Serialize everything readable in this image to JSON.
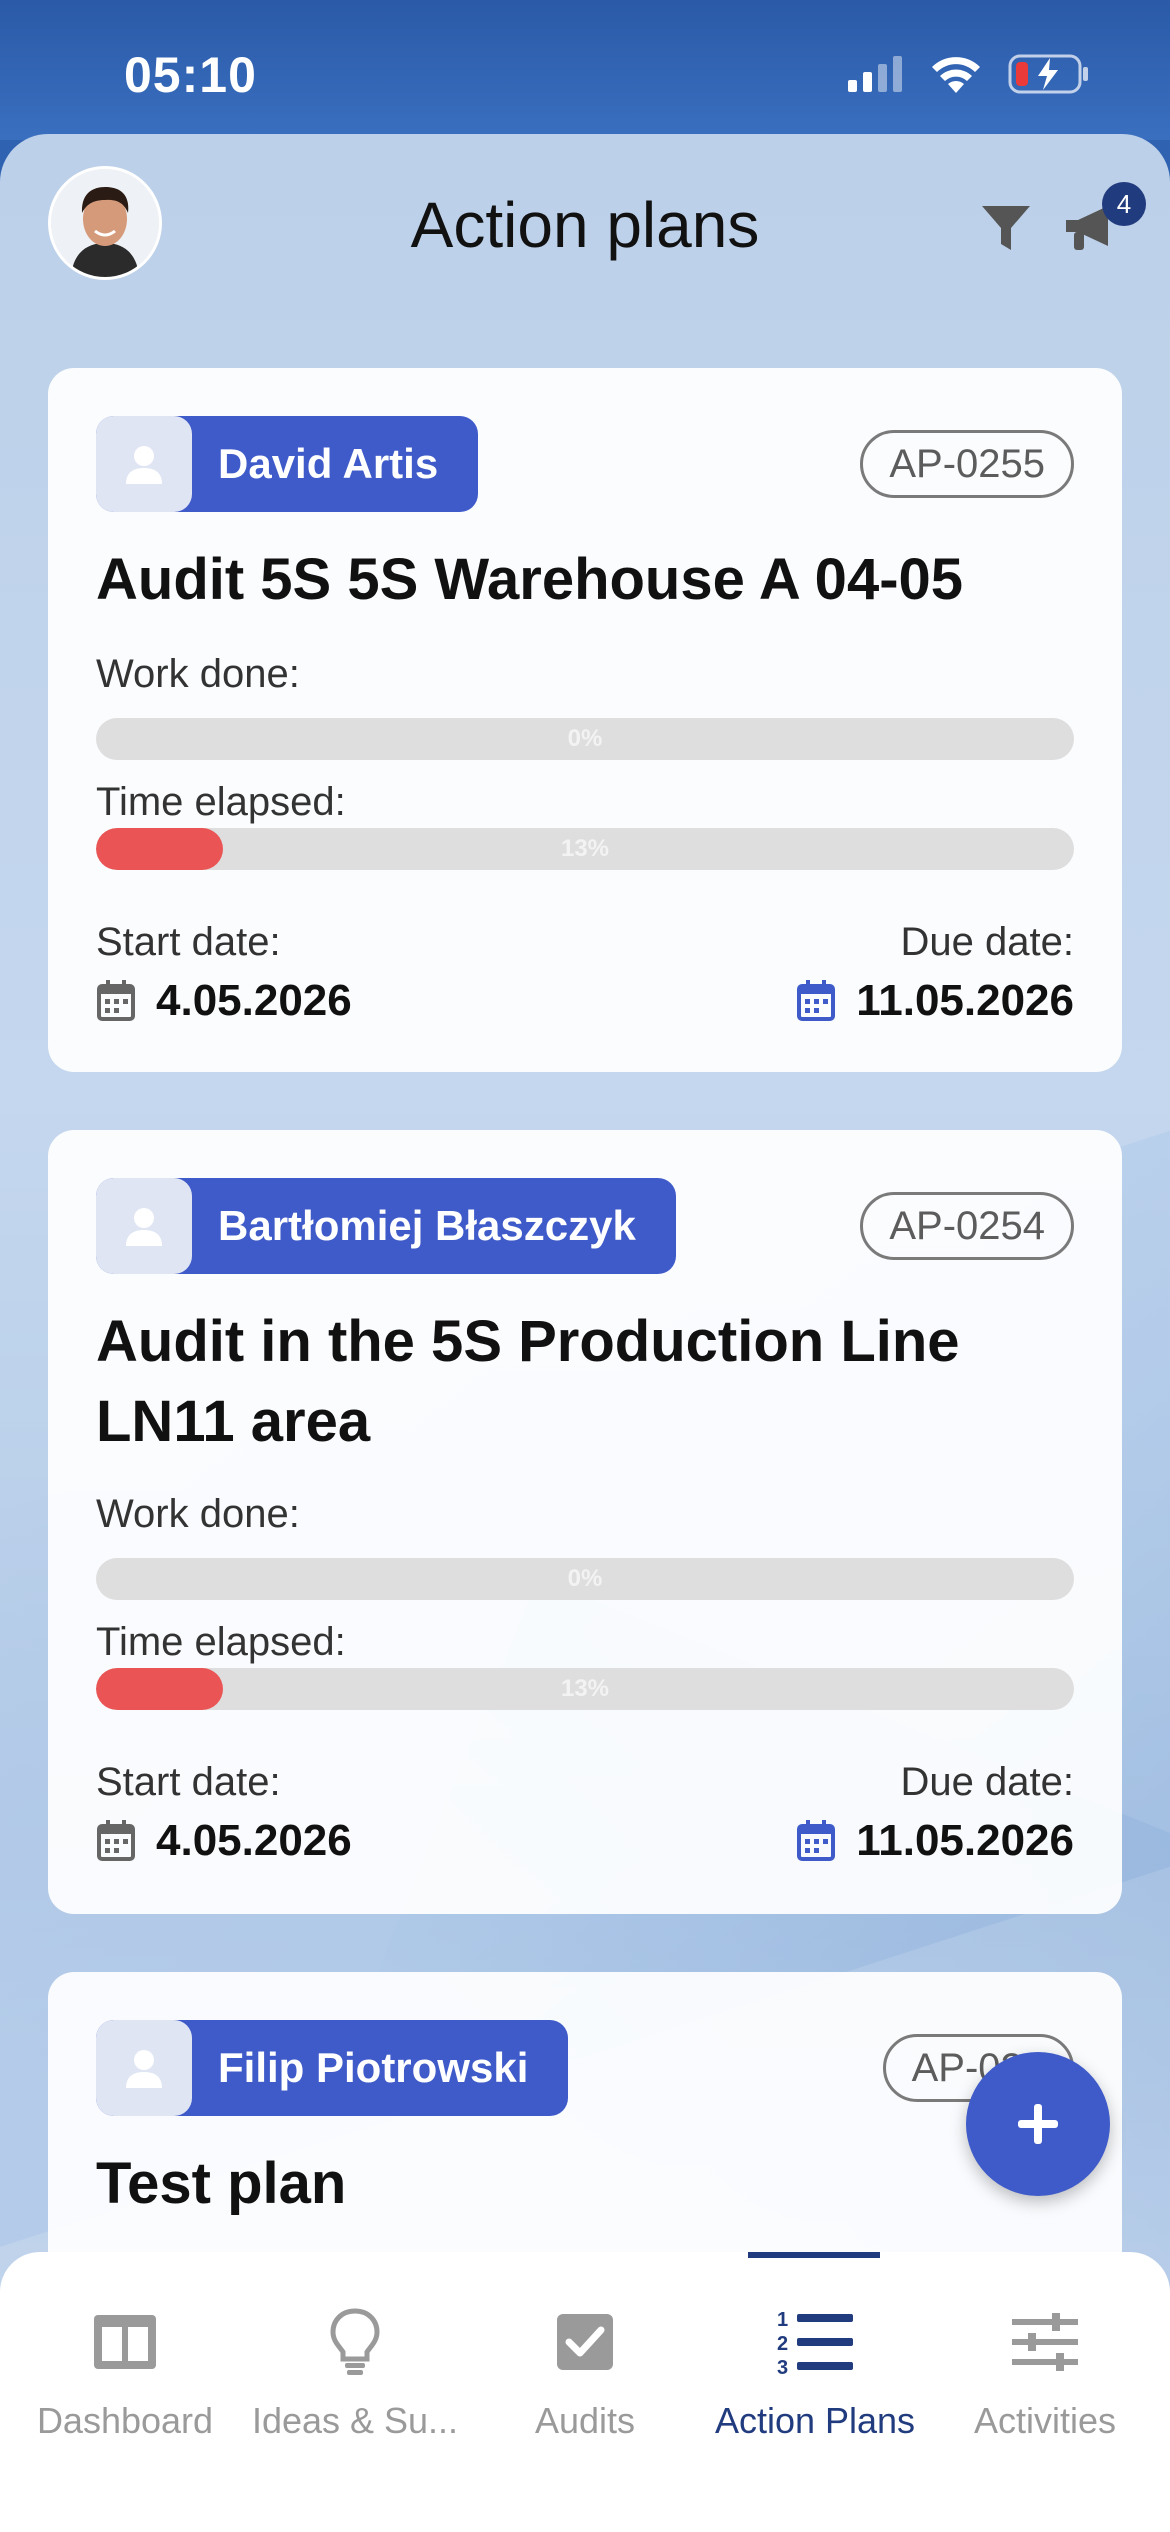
{
  "status_bar": {
    "time": "05:10"
  },
  "header": {
    "title": "Action plans",
    "notification_count": "4"
  },
  "cards": [
    {
      "assignee": "David Artis",
      "code": "AP-0255",
      "title": "Audit 5S 5S Warehouse A 04-05",
      "work_done_label": "Work done:",
      "work_done_percent": "0%",
      "work_done_value": 0,
      "time_elapsed_label": "Time elapsed:",
      "time_elapsed_percent": "13%",
      "time_elapsed_value": 13,
      "start_date_label": "Start date:",
      "start_date": "4.05.2026",
      "due_date_label": "Due date:",
      "due_date": "11.05.2026"
    },
    {
      "assignee": "Bartłomiej Błaszczyk",
      "code": "AP-0254",
      "title": "Audit in the 5S Production Line LN11 area",
      "work_done_label": "Work done:",
      "work_done_percent": "0%",
      "work_done_value": 0,
      "time_elapsed_label": "Time elapsed:",
      "time_elapsed_percent": "13%",
      "time_elapsed_value": 13,
      "start_date_label": "Start date:",
      "start_date": "4.05.2026",
      "due_date_label": "Due date:",
      "due_date": "11.05.2026"
    },
    {
      "assignee": "Filip Piotrowski",
      "code": "AP-025",
      "title": "Test plan"
    }
  ],
  "tabs": [
    {
      "label": "Dashboard",
      "icon": "dashboard-icon",
      "active": false
    },
    {
      "label": "Ideas & Su...",
      "icon": "lightbulb-icon",
      "active": false
    },
    {
      "label": "Audits",
      "icon": "checkbox-icon",
      "active": false
    },
    {
      "label": "Action Plans",
      "icon": "numbered-list-icon",
      "active": true
    },
    {
      "label": "Activities",
      "icon": "sliders-icon",
      "active": false
    }
  ],
  "colors": {
    "accent": "#3f5bc9",
    "active_tab": "#213b7f",
    "elapsed_bar": "#ea5455"
  }
}
